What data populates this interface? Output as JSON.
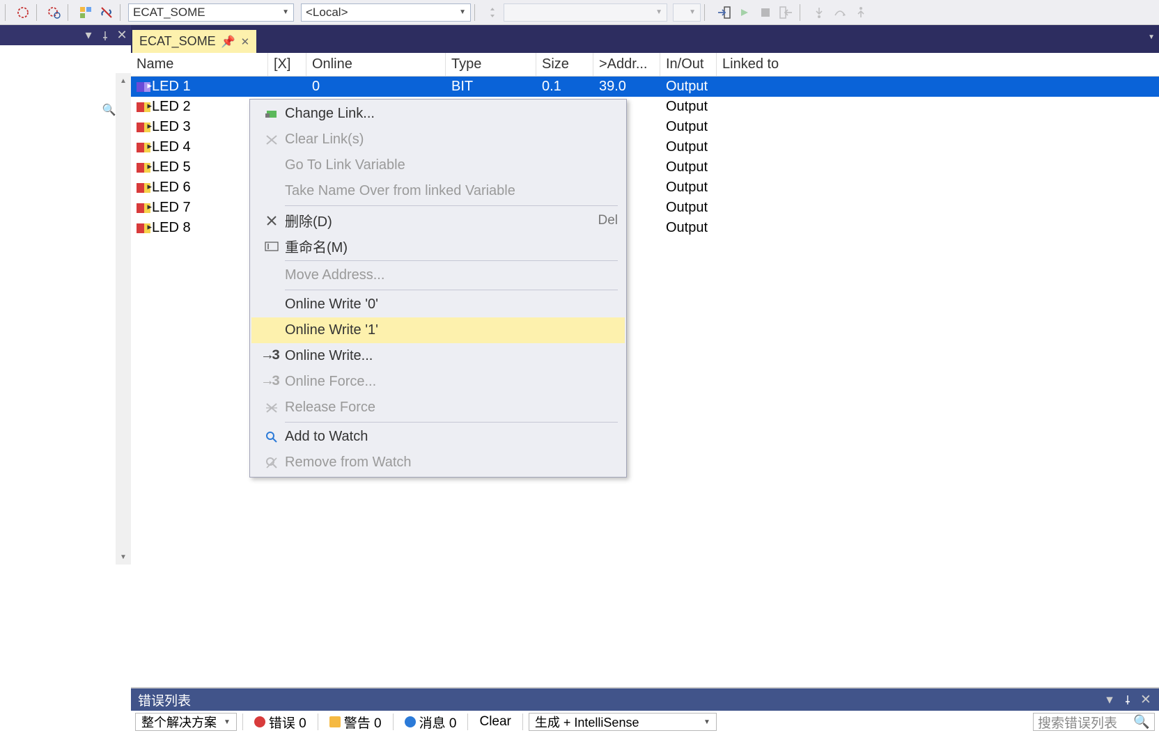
{
  "toolbar": {
    "select1": "ECAT_SOME",
    "select2": "<Local>"
  },
  "tab": {
    "title": "ECAT_SOME"
  },
  "headers": {
    "name": "Name",
    "x": "[X]",
    "online": "Online",
    "type": "Type",
    "size": "Size",
    "addr": ">Addr...",
    "inout": "In/Out",
    "linked": "Linked to"
  },
  "rows": [
    {
      "name": "LED 1",
      "x": "",
      "online": "0",
      "type": "BIT",
      "size": "0.1",
      "addr": "39.0",
      "inout": "Output",
      "linked": "",
      "selected": true
    },
    {
      "name": "LED 2",
      "x": "",
      "online": "",
      "type": "",
      "size": "",
      "addr": "",
      "inout": "Output",
      "linked": "",
      "selected": false
    },
    {
      "name": "LED 3",
      "x": "",
      "online": "",
      "type": "",
      "size": "",
      "addr": "",
      "inout": "Output",
      "linked": "",
      "selected": false
    },
    {
      "name": "LED 4",
      "x": "",
      "online": "",
      "type": "",
      "size": "",
      "addr": "",
      "inout": "Output",
      "linked": "",
      "selected": false
    },
    {
      "name": "LED 5",
      "x": "",
      "online": "",
      "type": "",
      "size": "",
      "addr": "",
      "inout": "Output",
      "linked": "",
      "selected": false
    },
    {
      "name": "LED 6",
      "x": "",
      "online": "",
      "type": "",
      "size": "",
      "addr": "",
      "inout": "Output",
      "linked": "",
      "selected": false
    },
    {
      "name": "LED 7",
      "x": "",
      "online": "",
      "type": "",
      "size": "",
      "addr": "",
      "inout": "Output",
      "linked": "",
      "selected": false
    },
    {
      "name": "LED 8",
      "x": "",
      "online": "",
      "type": "",
      "size": "",
      "addr": "",
      "inout": "Output",
      "linked": "",
      "selected": false
    }
  ],
  "context_menu": [
    {
      "icon": "link-icon",
      "label": "Change Link...",
      "disabled": false
    },
    {
      "icon": "clear-link-icon",
      "label": "Clear Link(s)",
      "disabled": true
    },
    {
      "icon": "",
      "label": "Go To Link Variable",
      "disabled": true
    },
    {
      "icon": "",
      "label": "Take Name Over from linked Variable",
      "disabled": true
    },
    {
      "sep": true
    },
    {
      "icon": "delete-icon",
      "label": "删除(D)",
      "shortcut": "Del",
      "disabled": false
    },
    {
      "icon": "rename-icon",
      "label": "重命名(M)",
      "disabled": false
    },
    {
      "sep": true
    },
    {
      "icon": "",
      "label": "Move Address...",
      "disabled": true
    },
    {
      "sep": true
    },
    {
      "icon": "",
      "label": "Online Write '0'",
      "disabled": false
    },
    {
      "icon": "",
      "label": "Online Write '1'",
      "disabled": false,
      "hover": true
    },
    {
      "icon": "write-icon",
      "label": "Online Write...",
      "disabled": false
    },
    {
      "icon": "force-icon",
      "label": "Online Force...",
      "disabled": true
    },
    {
      "icon": "release-icon",
      "label": "Release Force",
      "disabled": true
    },
    {
      "sep": true
    },
    {
      "icon": "magnifier-icon",
      "label": "Add to Watch",
      "disabled": false
    },
    {
      "icon": "remove-watch-icon",
      "label": "Remove from Watch",
      "disabled": true
    }
  ],
  "error_panel": {
    "title": "错误列表",
    "scope": "整个解决方案",
    "errors": "错误 0",
    "warnings": "警告 0",
    "messages": "消息 0",
    "clear": "Clear",
    "build": "生成 + IntelliSense",
    "search_placeholder": "搜索错误列表"
  }
}
